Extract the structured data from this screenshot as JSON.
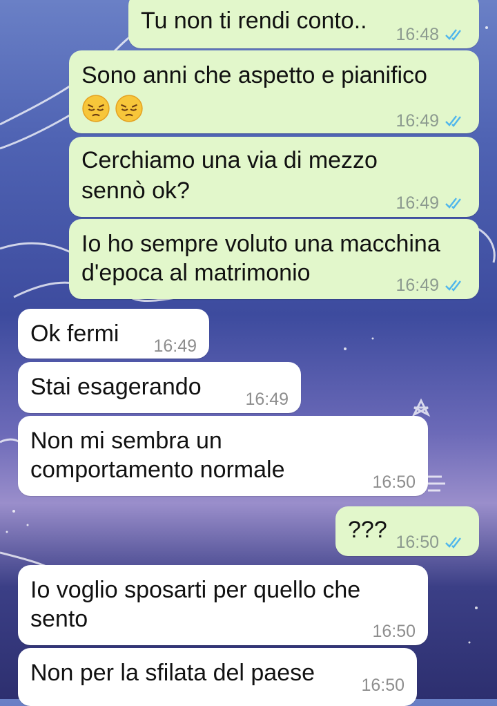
{
  "colors": {
    "outgoing_bubble": "#e2f7cb",
    "incoming_bubble": "#ffffff",
    "read_ticks": "#4fb6ec",
    "timestamp": "#8c9a8f"
  },
  "messages": [
    {
      "direction": "outgoing",
      "lines": [
        "Tu non ti rendi conto.."
      ],
      "time": "16:48",
      "status": "read"
    },
    {
      "direction": "outgoing",
      "lines": [
        "Sono anni che aspetto e pianifico"
      ],
      "emojis": [
        "pensive-face",
        "pensive-face"
      ],
      "time": "16:49",
      "status": "read"
    },
    {
      "direction": "outgoing",
      "lines": [
        "Cerchiamo una via di mezzo",
        "sennò ok?"
      ],
      "time": "16:49",
      "status": "read"
    },
    {
      "direction": "outgoing",
      "lines": [
        "Io ho sempre voluto una macchina",
        "d'epoca al matrimonio"
      ],
      "time": "16:49",
      "status": "read"
    },
    {
      "direction": "incoming",
      "lines": [
        "Ok fermi"
      ],
      "time": "16:49"
    },
    {
      "direction": "incoming",
      "lines": [
        "Stai esagerando"
      ],
      "time": "16:49"
    },
    {
      "direction": "incoming",
      "lines": [
        "Non mi sembra un",
        "comportamento normale"
      ],
      "time": "16:50"
    },
    {
      "direction": "outgoing",
      "lines": [
        "???"
      ],
      "time": "16:50",
      "status": "read"
    },
    {
      "direction": "incoming",
      "lines": [
        "Io voglio sposarti per quello che",
        "sento"
      ],
      "time": "16:50"
    },
    {
      "direction": "incoming",
      "lines": [
        "Non per la sfilata del paese"
      ],
      "time": "16:50"
    }
  ]
}
